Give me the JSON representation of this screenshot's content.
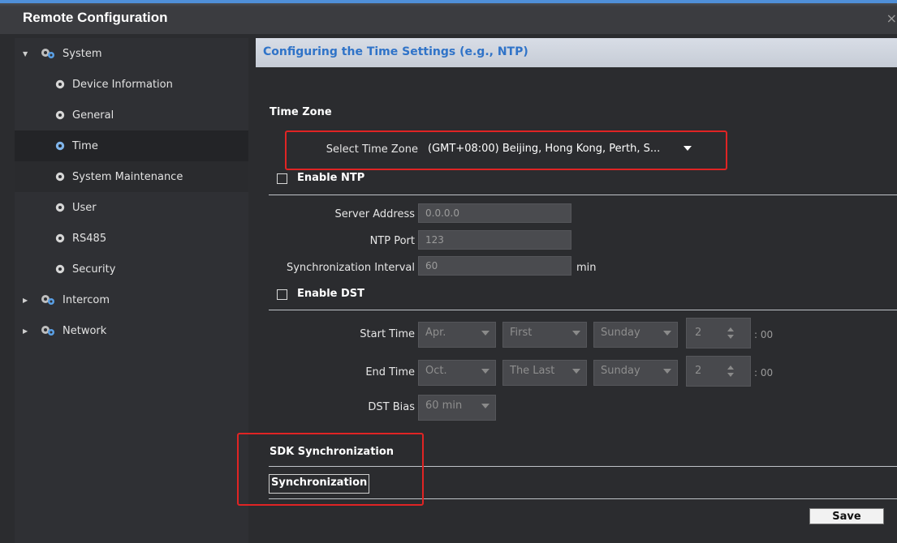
{
  "window": {
    "title": "Remote Configuration",
    "close_glyph": "×"
  },
  "sidebar": {
    "groups": [
      {
        "label": "System",
        "expanded": true,
        "icon": "system-gears-icon"
      },
      {
        "label": "Intercom",
        "expanded": false,
        "icon": "intercom-gears-icon"
      },
      {
        "label": "Network",
        "expanded": false,
        "icon": "network-gears-icon"
      }
    ],
    "items": [
      {
        "label": "Device Information",
        "icon": "gear-icon"
      },
      {
        "label": "General",
        "icon": "gear-icon"
      },
      {
        "label": "Time",
        "icon": "gear-icon",
        "selected": true
      },
      {
        "label": "System Maintenance",
        "icon": "gear-icon"
      },
      {
        "label": "User",
        "icon": "gear-icon"
      },
      {
        "label": "RS485",
        "icon": "gear-icon"
      },
      {
        "label": "Security",
        "icon": "gear-icon"
      }
    ]
  },
  "page": {
    "header": "Configuring the Time Settings (e.g., NTP)"
  },
  "time_zone": {
    "section_title": "Time Zone",
    "select_label": "Select Time Zone",
    "select_value": "(GMT+08:00) Beijing, Hong Kong, Perth, S..."
  },
  "ntp": {
    "enable_label": "Enable NTP",
    "enabled": false,
    "server_address_label": "Server Address",
    "server_address_value": "0.0.0.0",
    "port_label": "NTP Port",
    "port_value": "123",
    "interval_label": "Synchronization Interval",
    "interval_value": "60",
    "interval_unit": "min"
  },
  "dst": {
    "enable_label": "Enable DST",
    "enabled": false,
    "start_label": "Start Time",
    "start_month": "Apr.",
    "start_week": "First",
    "start_day": "Sunday",
    "start_hour": "2",
    "end_label": "End Time",
    "end_month": "Oct.",
    "end_week": "The Last",
    "end_day": "Sunday",
    "end_hour": "2",
    "minute_suffix": ": 00",
    "bias_label": "DST Bias",
    "bias_value": "60 min"
  },
  "sdk": {
    "section_title": "SDK Synchronization",
    "sync_button": "Synchronization"
  },
  "footer": {
    "save_button": "Save"
  },
  "colors": {
    "background": "#2b2c2f",
    "header_text": "#2f73c8",
    "highlight": "#e02424",
    "accent": "#4f8fd8"
  }
}
